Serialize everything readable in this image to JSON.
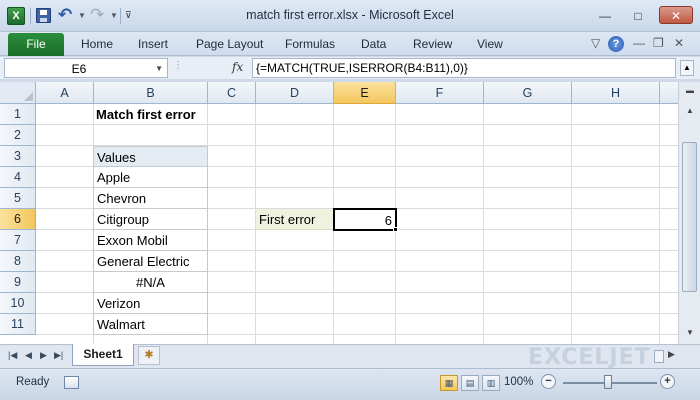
{
  "window": {
    "title": "match first error.xlsx  -  Microsoft Excel",
    "logo_letter": "X",
    "icons": [
      "excel-logo-icon",
      "save-icon",
      "undo-icon",
      "redo-icon",
      "customize-icon",
      "minimize-icon",
      "maximize-icon",
      "close-icon"
    ]
  },
  "ribbon": {
    "file_tab": "File",
    "tabs": [
      "Home",
      "Insert",
      "Page Layout",
      "Formulas",
      "Data",
      "Review",
      "View"
    ],
    "help": "?"
  },
  "formula_bar": {
    "name_box": "E6",
    "fx": "fx",
    "formula": "{=MATCH(TRUE,ISERROR(B4:B11),0)}"
  },
  "grid": {
    "columns": [
      "A",
      "B",
      "C",
      "D",
      "E",
      "F",
      "G",
      "H"
    ],
    "rows": [
      "1",
      "2",
      "3",
      "4",
      "5",
      "6",
      "7",
      "8",
      "9",
      "10",
      "11"
    ],
    "selected_column": "E",
    "selected_row": "6",
    "cells": {
      "B1": "Match first error",
      "B3": "Values",
      "B4": "Apple",
      "B5": "Chevron",
      "B6": "Citigroup",
      "B7": "Exxon Mobil",
      "B8": "General Electric",
      "B9": "#N/A",
      "B10": "Verizon",
      "B11": "Walmart",
      "D6": "First error",
      "E6": "6"
    }
  },
  "sheets": {
    "tabs": [
      "Sheet1"
    ],
    "active": "Sheet1",
    "watermark": "EXCELJET"
  },
  "status_bar": {
    "status": "Ready",
    "zoom": "100%",
    "zoom_minus": "−",
    "zoom_plus": "+"
  },
  "colors": {
    "file_tab": "#1e7b30",
    "selected_header": "#f5c95f",
    "label_fill": "#eef2df",
    "table_header_fill": "#e5ebf2"
  }
}
